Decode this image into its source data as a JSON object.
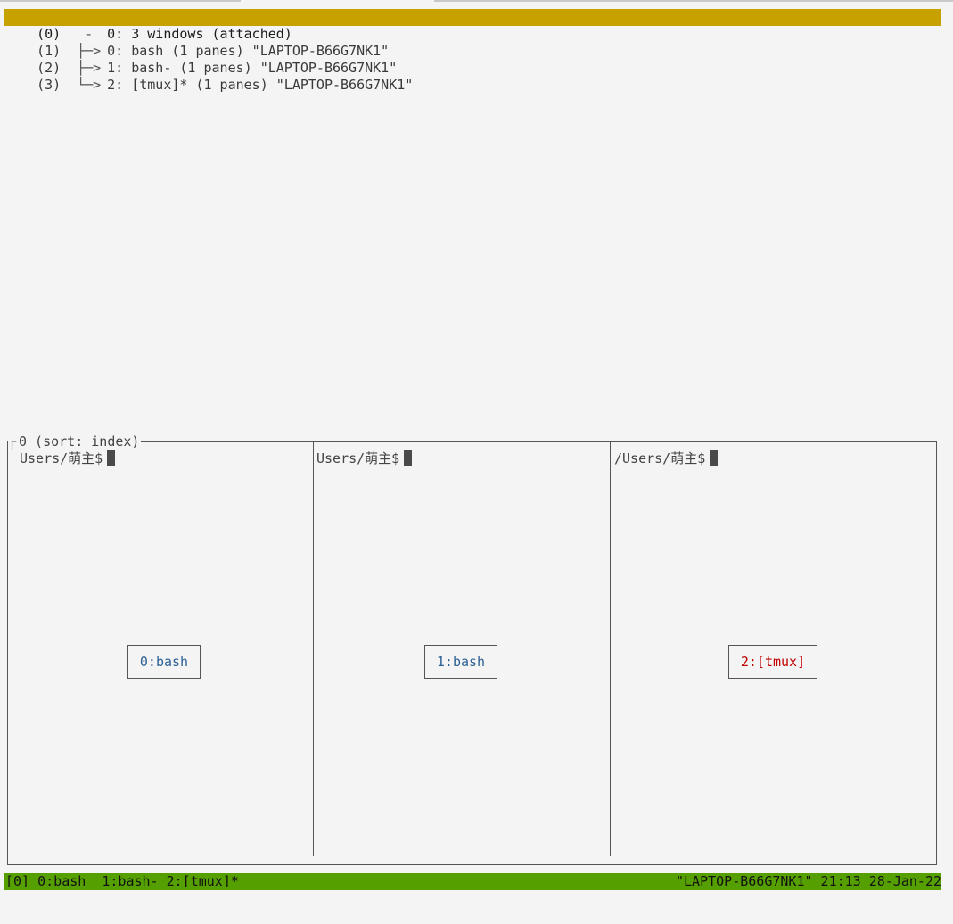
{
  "tree": {
    "rows": [
      {
        "index": "(0)",
        "branch": " - ",
        "text": "0: 3 windows (attached)"
      },
      {
        "index": "(1)",
        "branch": "├─>",
        "text": "0: bash (1 panes) \"LAPTOP-B66G7NK1\""
      },
      {
        "index": "(2)",
        "branch": "├─>",
        "text": "1: bash- (1 panes) \"LAPTOP-B66G7NK1\""
      },
      {
        "index": "(3)",
        "branch": "└─>",
        "text": "2: [tmux]* (1 panes) \"LAPTOP-B66G7NK1\""
      }
    ]
  },
  "preview": {
    "title": "0 (sort: index)",
    "panes": [
      {
        "prompt": "Users/萌主$",
        "label": "0:bash"
      },
      {
        "prompt": "Users/萌主$",
        "label": "1:bash"
      },
      {
        "prompt": "/Users/萌主$",
        "label": "2:[tmux]"
      }
    ]
  },
  "status": {
    "left": "[0] 0:bash  1:bash- 2:[tmux]*",
    "right": "\"LAPTOP-B66G7NK1\" 21:13 28-Jan-22"
  },
  "colors": {
    "selected_row": "#c6a100",
    "status_bar": "#55a000",
    "active_window_label": "#c00000",
    "window_label": "#2b5f94"
  }
}
